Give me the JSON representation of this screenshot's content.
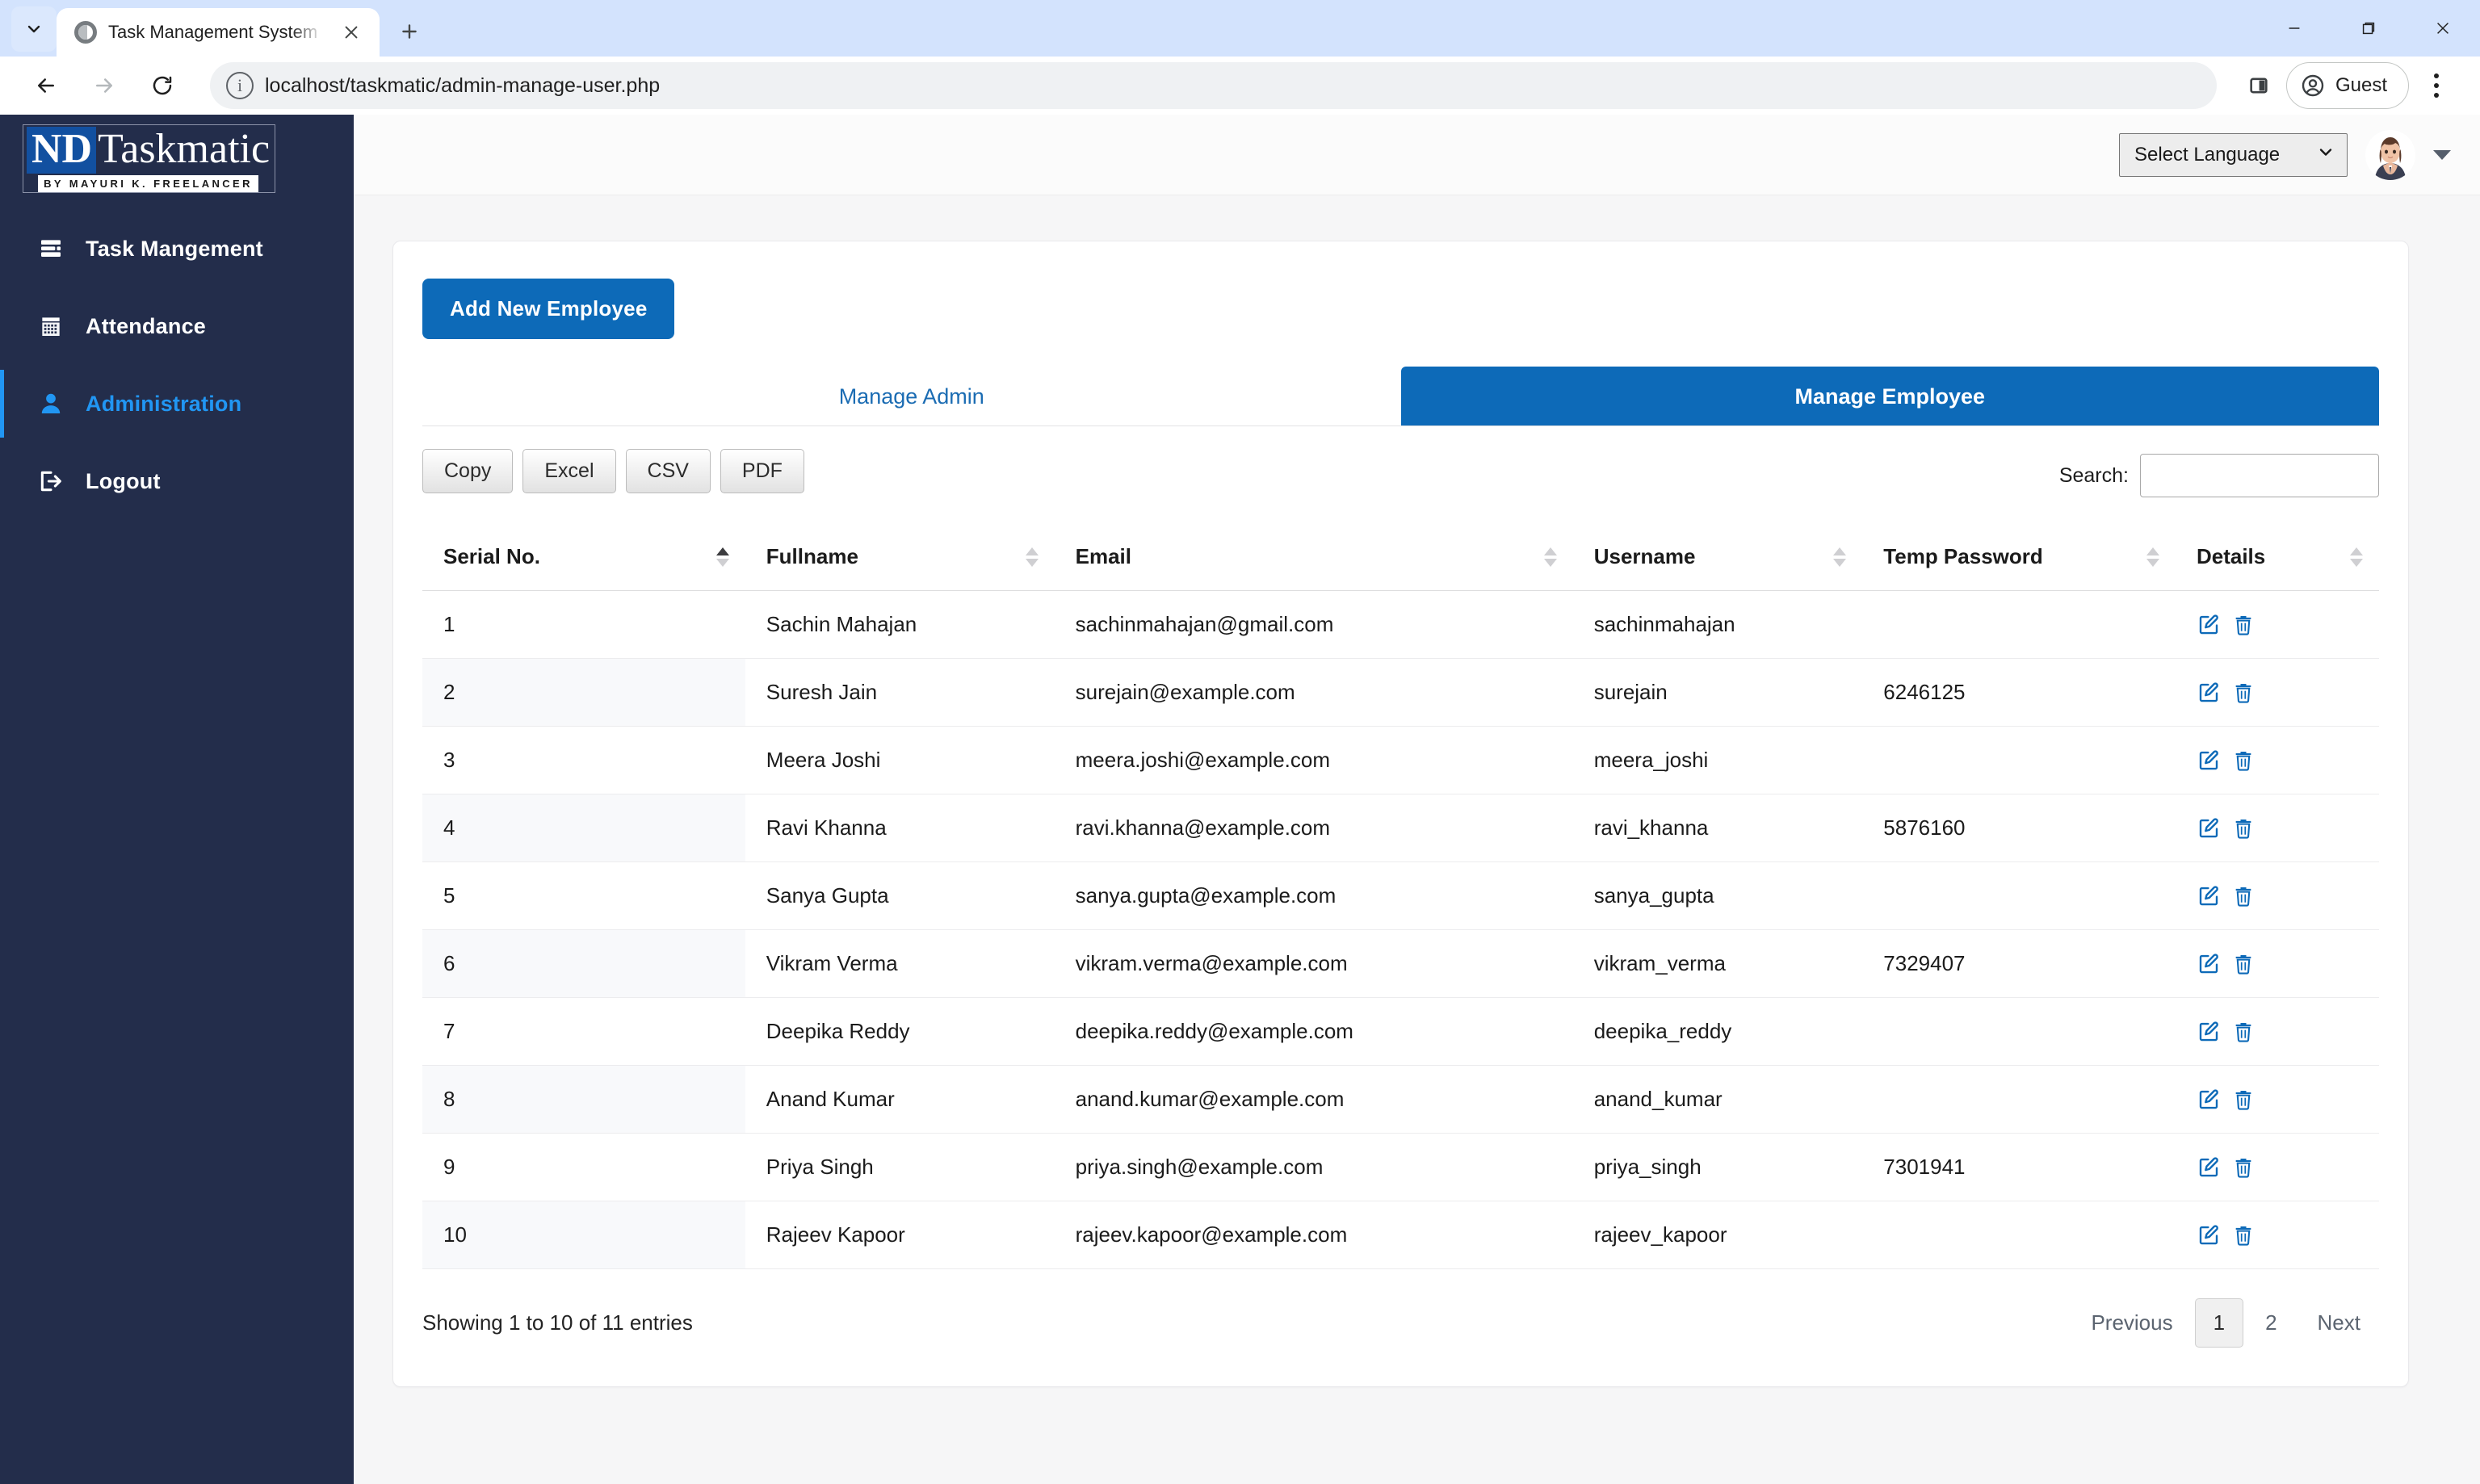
{
  "browser": {
    "tab_title": "Task Management System by M",
    "url": "localhost/taskmatic/admin-manage-user.php",
    "profile_label": "Guest",
    "new_tab_label": "+",
    "close_label": "✕"
  },
  "sidebar": {
    "logo": {
      "nd": "ND",
      "taskmatic": "Taskmatic",
      "subtitle": "BY MAYURI K. FREELANCER"
    },
    "items": [
      {
        "label": "Task Mangement",
        "icon": "tasks-icon",
        "active": false
      },
      {
        "label": "Attendance",
        "icon": "calendar-icon",
        "active": false
      },
      {
        "label": "Administration",
        "icon": "user-icon",
        "active": true
      },
      {
        "label": "Logout",
        "icon": "logout-icon",
        "active": false
      }
    ]
  },
  "topbar": {
    "language_selected": "Select Language",
    "avatar": "user-avatar"
  },
  "main": {
    "add_button": "Add New Employee",
    "tabs": [
      {
        "label": "Manage Admin",
        "active": false
      },
      {
        "label": "Manage Employee",
        "active": true
      }
    ],
    "export_buttons": [
      "Copy",
      "Excel",
      "CSV",
      "PDF"
    ],
    "search_label": "Search:",
    "search_value": "",
    "table": {
      "columns": [
        "Serial No.",
        "Fullname",
        "Email",
        "Username",
        "Temp Password",
        "Details"
      ],
      "sorted_column": 0,
      "sort_direction": "asc",
      "rows": [
        {
          "serial": "1",
          "fullname": "Sachin Mahajan",
          "email": "sachinmahajan@gmail.com",
          "username": "sachinmahajan",
          "temp_password": ""
        },
        {
          "serial": "2",
          "fullname": "Suresh Jain",
          "email": "surejain@example.com",
          "username": "surejain",
          "temp_password": "6246125"
        },
        {
          "serial": "3",
          "fullname": "Meera Joshi",
          "email": "meera.joshi@example.com",
          "username": "meera_joshi",
          "temp_password": ""
        },
        {
          "serial": "4",
          "fullname": "Ravi Khanna",
          "email": "ravi.khanna@example.com",
          "username": "ravi_khanna",
          "temp_password": "5876160"
        },
        {
          "serial": "5",
          "fullname": "Sanya Gupta",
          "email": "sanya.gupta@example.com",
          "username": "sanya_gupta",
          "temp_password": ""
        },
        {
          "serial": "6",
          "fullname": "Vikram Verma",
          "email": "vikram.verma@example.com",
          "username": "vikram_verma",
          "temp_password": "7329407"
        },
        {
          "serial": "7",
          "fullname": "Deepika Reddy",
          "email": "deepika.reddy@example.com",
          "username": "deepika_reddy",
          "temp_password": ""
        },
        {
          "serial": "8",
          "fullname": "Anand Kumar",
          "email": "anand.kumar@example.com",
          "username": "anand_kumar",
          "temp_password": ""
        },
        {
          "serial": "9",
          "fullname": "Priya Singh",
          "email": "priya.singh@example.com",
          "username": "priya_singh",
          "temp_password": "7301941"
        },
        {
          "serial": "10",
          "fullname": "Rajeev Kapoor",
          "email": "rajeev.kapoor@example.com",
          "username": "rajeev_kapoor",
          "temp_password": ""
        }
      ]
    },
    "entries_info": "Showing 1 to 10 of 11 entries",
    "pagination": {
      "previous": "Previous",
      "pages": [
        "1",
        "2"
      ],
      "current_page": "1",
      "next": "Next"
    }
  },
  "colors": {
    "sidebar_bg": "#232d4b",
    "accent_blue": "#0d6ab8",
    "active_nav": "#2196f3",
    "link_blue": "#1b6cb3"
  }
}
